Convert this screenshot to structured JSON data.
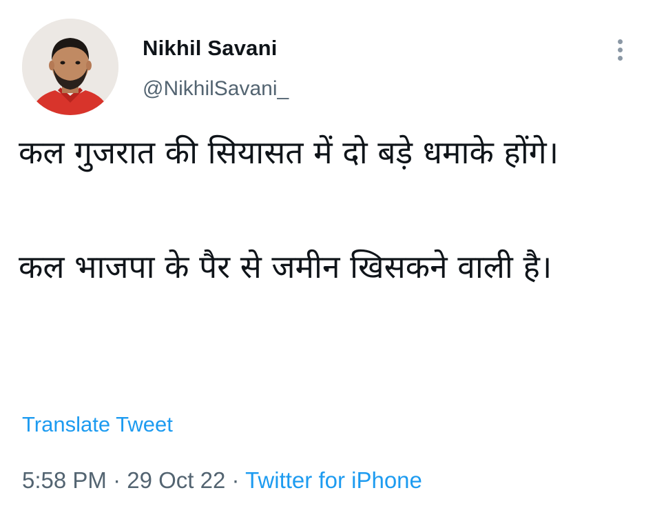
{
  "author": {
    "display_name": "Nikhil Savani",
    "handle": "@NikhilSavani_"
  },
  "tweet": {
    "line_1": "कल गुजरात की सियासत में दो बड़े धमाके होंगे।",
    "line_2": "कल भाजपा के पैर से जमीन खिसकने वाली है।"
  },
  "actions": {
    "translate_label": "Translate Tweet"
  },
  "meta": {
    "time": "5:58 PM",
    "separator_1": "·",
    "date": "29 Oct 22",
    "separator_2": "·",
    "source": "Twitter for iPhone"
  },
  "icons": {
    "more": "more-vertical-icon",
    "avatar": "avatar"
  },
  "colors": {
    "link": "#1d9bf0",
    "secondary_text": "#536471",
    "primary_text": "#0f1419",
    "avatar_shirt": "#d8342b"
  }
}
